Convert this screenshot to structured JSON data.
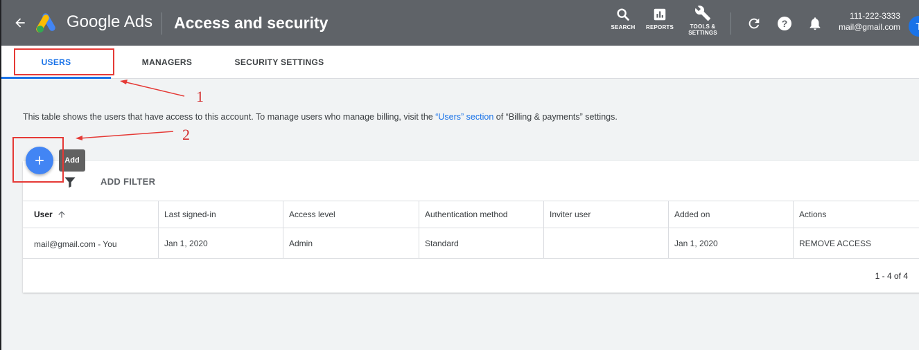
{
  "header": {
    "brand": "Google Ads",
    "page_title": "Access and security",
    "tools": [
      {
        "label": "SEARCH",
        "icon": "search-icon"
      },
      {
        "label": "REPORTS",
        "icon": "reports-icon"
      },
      {
        "label_line1": "TOOLS &",
        "label_line2": "SETTINGS",
        "icon": "wrench-icon"
      }
    ],
    "account_phone": "111-222-3333",
    "account_email": "mail@gmail.com",
    "avatar_letter": "T"
  },
  "tabs": [
    {
      "label": "USERS",
      "active": true
    },
    {
      "label": "MANAGERS",
      "active": false
    },
    {
      "label": "SECURITY SETTINGS",
      "active": false
    }
  ],
  "info": {
    "before": "This table shows the users that have access to this account. To manage users who manage billing, visit the ",
    "link": "“Users” section",
    "after": " of “Billing & payments” settings."
  },
  "fab": {
    "tooltip": "Add"
  },
  "filter": {
    "label": "ADD FILTER"
  },
  "table": {
    "columns": [
      "User",
      "Last signed-in",
      "Access level",
      "Authentication method",
      "Inviter user",
      "Added on",
      "Actions"
    ],
    "rows": [
      {
        "user": "mail@gmail.com - You",
        "last_signed_in": "Jan 1, 2020",
        "access_level": "Admin",
        "auth_method": "Standard",
        "inviter": "",
        "added_on": "Jan 1, 2020",
        "action": "REMOVE ACCESS"
      }
    ],
    "pagination": "1 - 4 of 4"
  },
  "annotations": {
    "label1": "1",
    "label2": "2"
  },
  "colors": {
    "header_bg": "#5f6368",
    "accent": "#1a73e8",
    "fab": "#4285f4",
    "annotation": "#e53935"
  }
}
